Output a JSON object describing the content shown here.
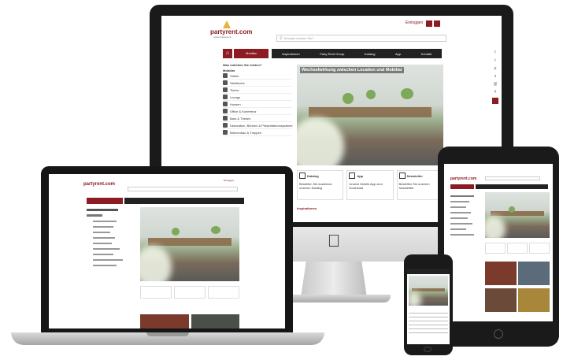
{
  "site": {
    "logo": "partyrent.com",
    "logo_sub": "rental equipment",
    "login": "Einloggen",
    "search_placeholder": "Wonach suchen Sie?",
    "nav": [
      "Inspirationen",
      "Party Rent Group",
      "Katalog",
      "App",
      "Kontakt"
    ],
    "sidebar_tab": "Mobiliar",
    "sidebar_heading": "Was möchten Sie mieten?",
    "sidebar_group": "Mobiliar",
    "sidebar_items": [
      "Stühle",
      "Stehtische",
      "Tische",
      "Lounge",
      "Hussen",
      "Office & Konferenz",
      "Bars & Theken",
      "Dekoration, Bühnen & Präsentationssysteme",
      "Bühnenbau & Treppen"
    ],
    "hero_title": "Wechselwirkung zwischen Location und Mobiliar",
    "cards": [
      {
        "title": "Katalog",
        "text": "Bestellen Sie kostenlos unseren Katalog"
      },
      {
        "title": "App",
        "text": "Unsere Mobile App zum Download"
      },
      {
        "title": "Newsletter",
        "text": "Bestellen Sie unseren Newsletter"
      }
    ],
    "section_label": "Inspirationen"
  },
  "colors": {
    "accent": "#8c1b22",
    "nav_bar": "#222222",
    "bezel": "#1a1a1a"
  }
}
